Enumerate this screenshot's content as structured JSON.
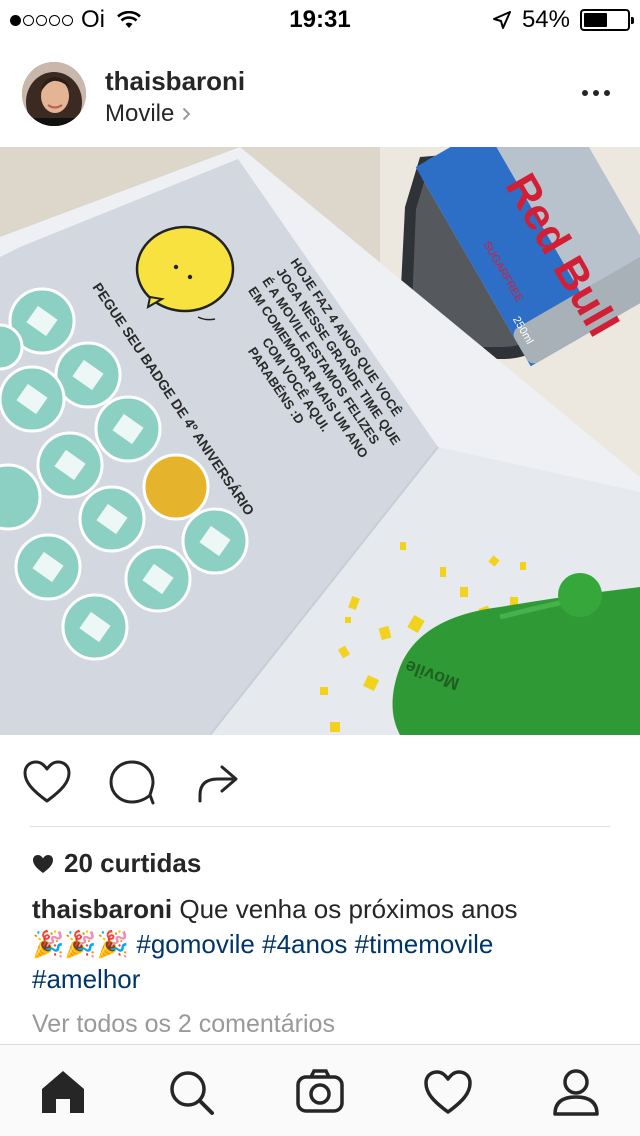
{
  "status_bar": {
    "carrier": "Oi",
    "time": "19:31",
    "battery": "54%",
    "battery_level": 0.54,
    "signal_dots": 1
  },
  "post": {
    "username": "thaisbaroni",
    "location": "Movile",
    "likes": "20 curtidas",
    "caption_user": "thaisbaroni",
    "caption_text": " Que venha os próximos anos",
    "caption_emoji": "🎉🎉🎉",
    "hashtags": [
      "#gomovile",
      "#4anos",
      "#timemovile",
      "#amelhor"
    ],
    "view_comments": "Ver todos os 2 comentários"
  },
  "photo": {
    "message": [
      "HOJE FAZ 4 ANOS QUE VOCÊ",
      "JOGA NESSE GRANDE TIME QUE",
      "É A MOVILE ESTAMOS FELIZES",
      "EM COMEMORAR MAIS UM ANO",
      "COM VOCÊ AQUI.",
      "PARABÉNS :D"
    ],
    "badge_label": "PEGUE SEU BADGE DE 4º ANIVERSÁRIO",
    "badges": [
      "1",
      "2",
      "3",
      "4",
      "5",
      "7",
      "8",
      "9",
      "10",
      "13",
      "14",
      "15"
    ],
    "can_text": "SUGARFREE",
    "can_volume": "250ml",
    "can_brand": "Red Bull",
    "balloon_text": "Movile"
  },
  "icons": [
    "heart-icon",
    "comment-icon",
    "share-icon",
    "home-icon",
    "search-icon",
    "camera-icon",
    "activity-icon",
    "profile-icon"
  ]
}
